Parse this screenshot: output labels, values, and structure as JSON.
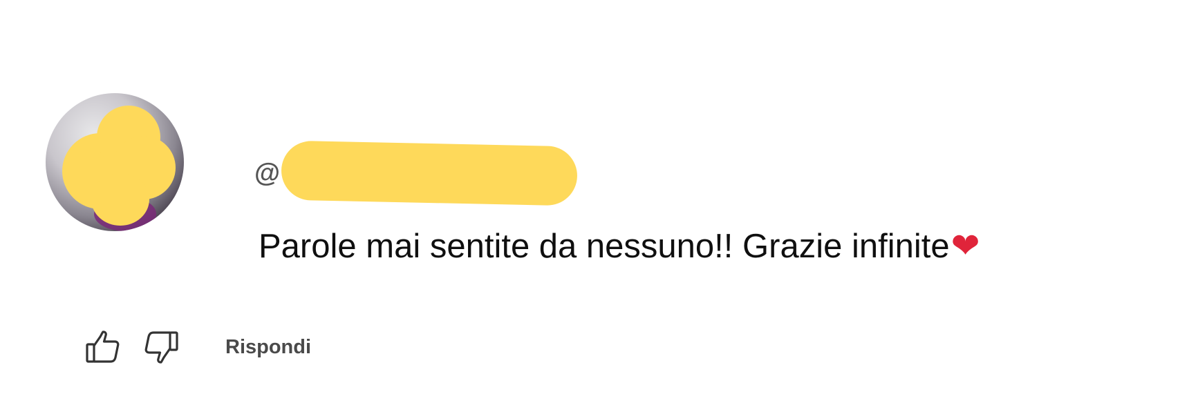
{
  "comment": {
    "author_prefix": "@",
    "text": "Parole mai sentite da nessuno!! Grazie infinite",
    "emoji": "❤"
  },
  "actions": {
    "like_icon": "thumbs-up-icon",
    "dislike_icon": "thumbs-down-icon",
    "reply_label": "Rispondi"
  },
  "colors": {
    "redaction": "#fed95a",
    "heart": "#e0243a",
    "text": "#0f0f0f",
    "secondary_text": "#4a4a4a"
  }
}
